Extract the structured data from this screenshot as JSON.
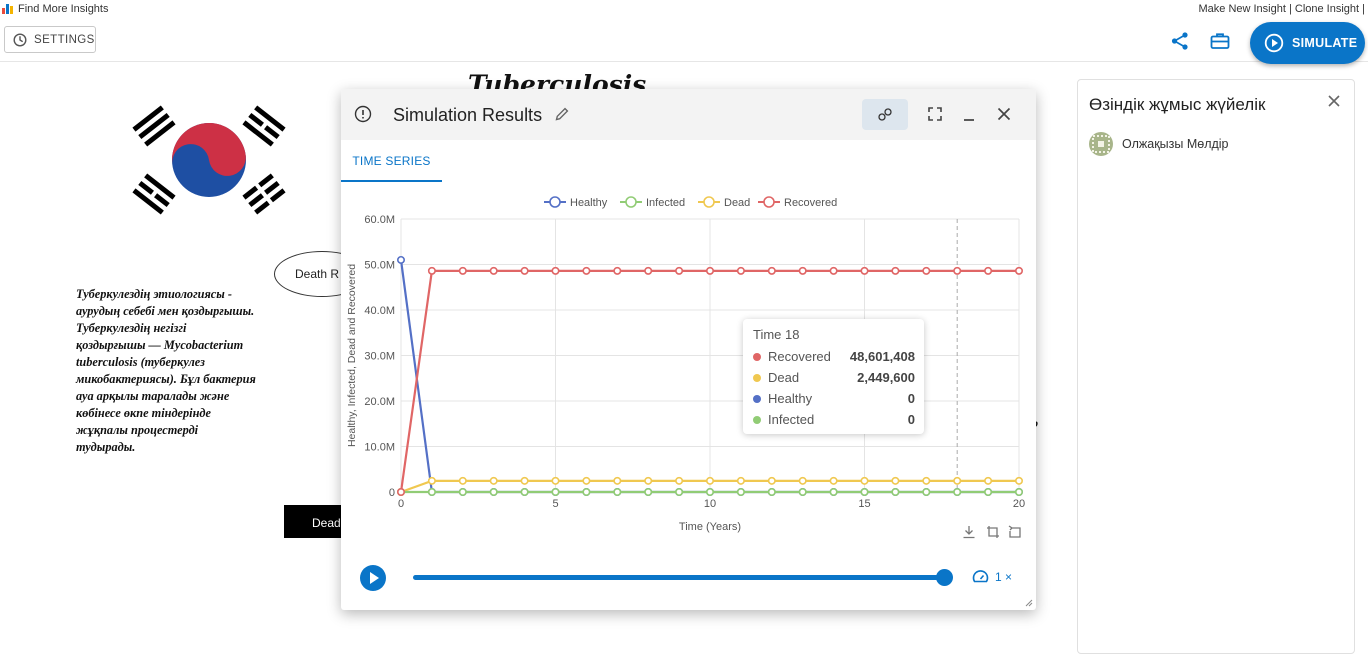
{
  "header": {
    "brand_text": "Find More Insights",
    "links": "Make New Insight | Clone Insight |",
    "settings_label": "SETTINGS",
    "simulate_label": "SIMULATE"
  },
  "canvas": {
    "title": "Tuberculosis",
    "death_node_label": "Death R",
    "description": "Туберкулездің этиологиясы -\n аурудың себебі мен қоздырғышы.\nТуберкулездің негізгі\nқоздырғышы — Mycobacterium\ntuberculosis (туберкулез\nмикобактериясы). Бұл бактерия\nауа арқылы таралады және\nкөбінесе өкпе тіндерінде\nжұқпалы процестерді\nтудырады.",
    "dead_box_label": "Dead",
    "stray_label": "р"
  },
  "right_panel": {
    "title": "Өзіндік жұмыс жүйелік",
    "user_name": "Олжақызы Мөлдір"
  },
  "modal": {
    "title": "Simulation Results",
    "tab_label": "TIME SERIES",
    "speed_label": "1 ×"
  },
  "tooltip": {
    "title": "Time 18",
    "rows": [
      {
        "label": "Recovered",
        "value": "48,601,408",
        "color": "#e06666"
      },
      {
        "label": "Dead",
        "value": "2,449,600",
        "color": "#f0c850"
      },
      {
        "label": "Healthy",
        "value": "0",
        "color": "#5470c6"
      },
      {
        "label": "Infected",
        "value": "0",
        "color": "#91cc75"
      }
    ]
  },
  "chart_data": {
    "type": "line",
    "title": "",
    "xlabel": "Time (Years)",
    "ylabel": "Healthy, Infected, Dead and Recovered",
    "xlim": [
      0,
      20
    ],
    "ylim": [
      0,
      60000000
    ],
    "x_ticks": [
      0,
      5,
      10,
      15,
      20
    ],
    "y_ticks": [
      0,
      10000000,
      20000000,
      30000000,
      40000000,
      50000000,
      60000000
    ],
    "y_tick_labels": [
      "0",
      "10.0M",
      "20.0M",
      "30.0M",
      "40.0M",
      "50.0M",
      "60.0M"
    ],
    "x": [
      0,
      1,
      2,
      3,
      4,
      5,
      6,
      7,
      8,
      9,
      10,
      11,
      12,
      13,
      14,
      15,
      16,
      17,
      18,
      19,
      20
    ],
    "hover_x": 18,
    "legend_position": "top-center",
    "grid": true,
    "series": [
      {
        "name": "Healthy",
        "color": "#5470c6",
        "values": [
          51000000,
          0,
          0,
          0,
          0,
          0,
          0,
          0,
          0,
          0,
          0,
          0,
          0,
          0,
          0,
          0,
          0,
          0,
          0,
          0,
          0
        ]
      },
      {
        "name": "Infected",
        "color": "#91cc75",
        "values": [
          0,
          0,
          0,
          0,
          0,
          0,
          0,
          0,
          0,
          0,
          0,
          0,
          0,
          0,
          0,
          0,
          0,
          0,
          0,
          0,
          0
        ]
      },
      {
        "name": "Dead",
        "color": "#f0c850",
        "values": [
          0,
          2449600,
          2449600,
          2449600,
          2449600,
          2449600,
          2449600,
          2449600,
          2449600,
          2449600,
          2449600,
          2449600,
          2449600,
          2449600,
          2449600,
          2449600,
          2449600,
          2449600,
          2449600,
          2449600,
          2449600
        ]
      },
      {
        "name": "Recovered",
        "color": "#e06666",
        "values": [
          0,
          48601408,
          48601408,
          48601408,
          48601408,
          48601408,
          48601408,
          48601408,
          48601408,
          48601408,
          48601408,
          48601408,
          48601408,
          48601408,
          48601408,
          48601408,
          48601408,
          48601408,
          48601408,
          48601408,
          48601408
        ]
      }
    ]
  }
}
